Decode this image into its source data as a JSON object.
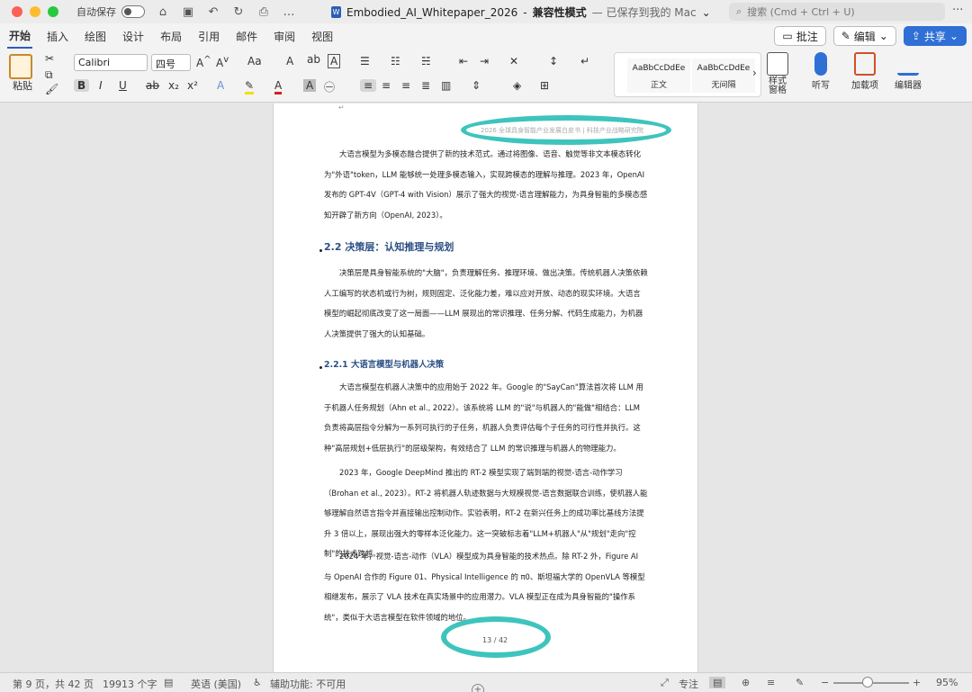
{
  "titlebar": {
    "autosave_label": "自动保存",
    "doc_name": "Embodied_AI_Whitepaper_2026",
    "separator": "-",
    "mode": "兼容性模式",
    "saved_status": "— 已保存到我的 Mac",
    "search_placeholder": "搜索 (Cmd + Ctrl + U)"
  },
  "tabs": [
    "开始",
    "插入",
    "绘图",
    "设计",
    "布局",
    "引用",
    "邮件",
    "审阅",
    "视图"
  ],
  "tab_actions": {
    "comment": "批注",
    "edit": "编辑",
    "share": "共享"
  },
  "ribbon": {
    "paste": "粘贴",
    "font_name": "Calibri",
    "font_size": "四号",
    "styles": [
      {
        "preview": "AaBbCcDdEe",
        "name": "正文"
      },
      {
        "preview": "AaBbCcDdEe",
        "name": "无间隔"
      }
    ],
    "styles_pane": "样式\n窗格",
    "dictate": "听写",
    "addins": "加载项",
    "editor": "编辑器"
  },
  "document": {
    "header": "2026 全球具身智能产业发展白皮书 | 科技产业战略研究院",
    "p1": "大语言模型为多模态融合提供了新的技术范式。通过将图像、语音、触觉等非文本模态转化为\"外语\"token，LLM 能够统一处理多模态输入，实现跨模态的理解与推理。2023 年，OpenAI 发布的 GPT-4V（GPT-4 with Vision）展示了强大的视觉-语言理解能力，为具身智能的多模态感知开辟了新方向（OpenAI, 2023）。",
    "h2": "2.2 决策层：认知推理与规划",
    "p2": "决策层是具身智能系统的\"大脑\"，负责理解任务、推理环境、做出决策。传统机器人决策依赖人工编写的状态机或行为树，规则固定、泛化能力差，难以应对开放、动态的现实环境。大语言模型的崛起彻底改变了这一局面——LLM 展现出的常识推理、任务分解、代码生成能力，为机器人决策提供了强大的认知基础。",
    "h3": "2.2.1 大语言模型与机器人决策",
    "p3": "大语言模型在机器人决策中的应用始于 2022 年。Google 的\"SayCan\"算法首次将 LLM 用于机器人任务规划（Ahn et al., 2022）。该系统将 LLM 的\"说\"与机器人的\"能做\"相结合：LLM 负责将高层指令分解为一系列可执行的子任务，机器人负责评估每个子任务的可行性并执行。这种\"高层规划+低层执行\"的层级架构，有效结合了 LLM 的常识推理与机器人的物理能力。",
    "p4": "2023 年，Google DeepMind 推出的 RT-2 模型实现了端到端的视觉-语言-动作学习（Brohan et al., 2023）。RT-2 将机器人轨迹数据与大规模视觉-语言数据联合训练，使机器人能够理解自然语言指令并直接输出控制动作。实验表明，RT-2 在新兴任务上的成功率比基线方法提升 3 倍以上，展现出强大的零样本泛化能力。这一突破标志着\"LLM+机器人\"从\"规划\"走向\"控制\"的技术跨越。",
    "p5": "2024 年，视觉-语言-动作（VLA）模型成为具身智能的技术热点。除 RT-2 外，Figure AI 与 OpenAI 合作的 Figure 01、Physical Intelligence 的 π0、斯坦福大学的 OpenVLA 等模型相继发布，展示了 VLA 技术在真实场景中的应用潜力。VLA 模型正在成为具身智能的\"操作系统\"，类似于大语言模型在软件领域的地位。",
    "page_number": "13 / 42"
  },
  "statusbar": {
    "page": "第 9 页，共 42 页",
    "words": "19913 个字",
    "language": "英语 (美国)",
    "accessibility": "辅助功能: 不可用",
    "focus": "专注",
    "zoom": "95%"
  },
  "colors": {
    "accent": "#2b5fb3",
    "annotation": "#3ec4bd",
    "heading": "#2b4f84"
  }
}
